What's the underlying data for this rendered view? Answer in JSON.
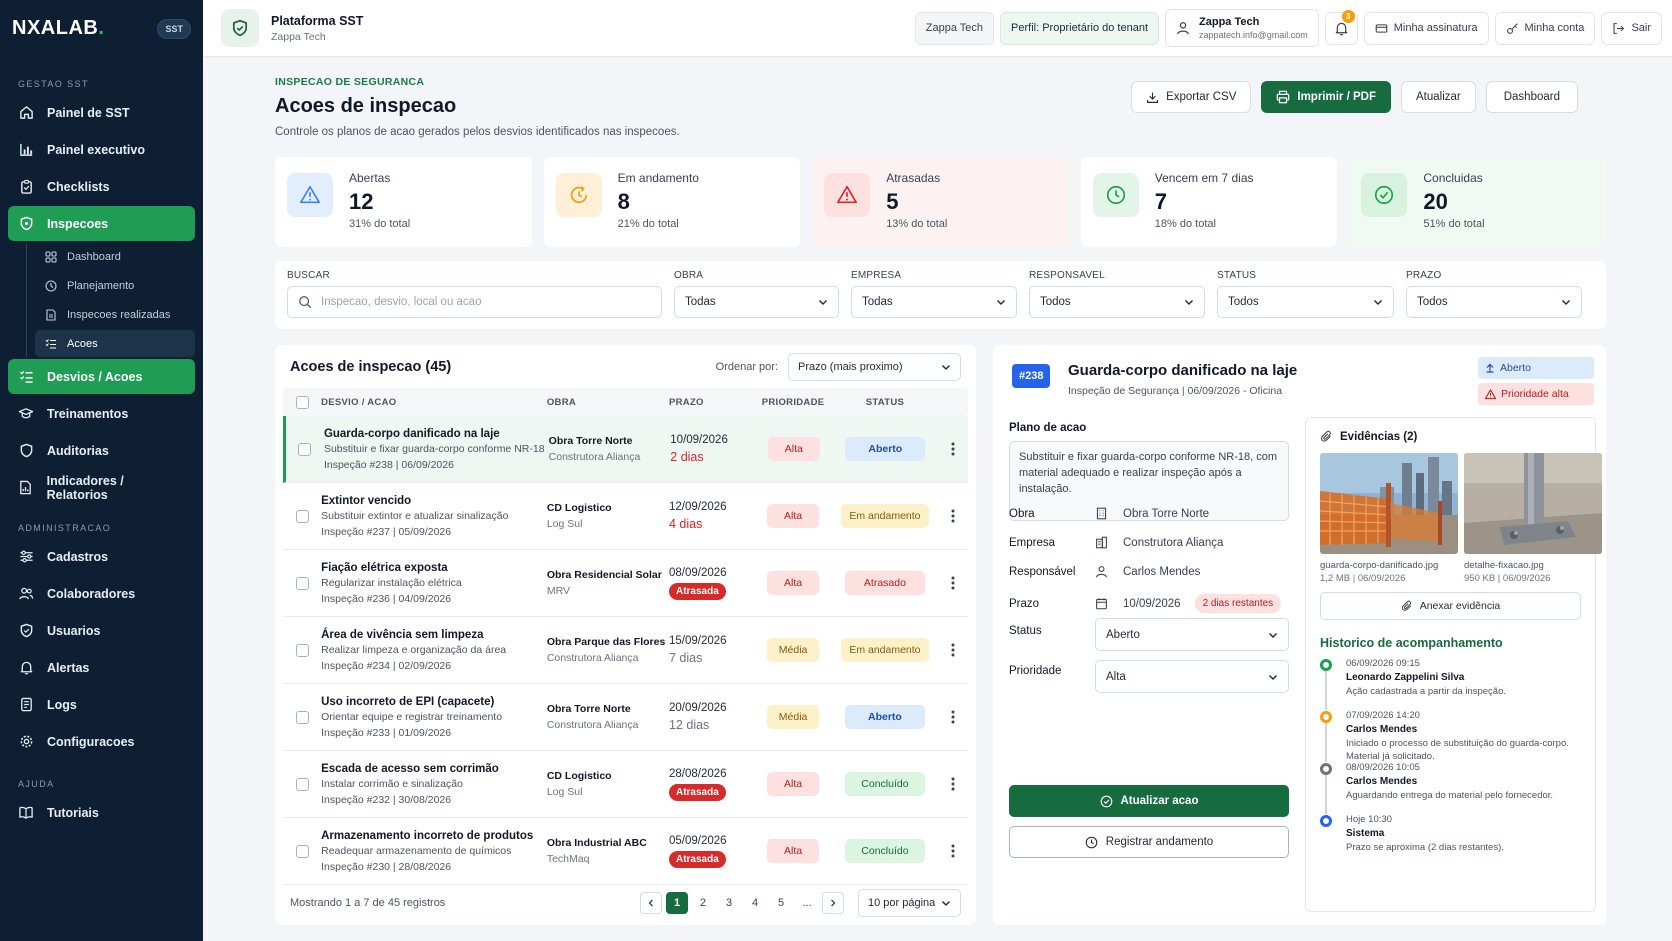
{
  "brand": {
    "logo": "NXALAB",
    "logo_dot": ".",
    "badge": "SST"
  },
  "sidebar": {
    "sections": [
      {
        "label": "GESTAO SST"
      },
      {
        "label": "ADMINISTRACAO"
      },
      {
        "label": "AJUDA"
      }
    ],
    "items": [
      {
        "label": "Painel de SST",
        "icon": "home-icon"
      },
      {
        "label": "Painel executivo",
        "icon": "bar-chart-icon"
      },
      {
        "label": "Checklists",
        "icon": "clipboard-icon"
      },
      {
        "label": "Inspecoes",
        "icon": "shield-icon",
        "active": true
      },
      {
        "label": "Desvios / Acoes",
        "icon": "list-check-icon",
        "active": true
      },
      {
        "label": "Treinamentos",
        "icon": "graduation-cap-icon"
      },
      {
        "label": "Auditorias",
        "icon": "shield-icon"
      },
      {
        "label": "Indicadores / Relatorios",
        "icon": "report-icon"
      },
      {
        "label": "Cadastros",
        "icon": "sliders-icon"
      },
      {
        "label": "Colaboradores",
        "icon": "users-icon"
      },
      {
        "label": "Usuarios",
        "icon": "shield-icon"
      },
      {
        "label": "Alertas",
        "icon": "bell-icon"
      },
      {
        "label": "Logs",
        "icon": "log-icon"
      },
      {
        "label": "Configuracoes",
        "icon": "gear-icon"
      },
      {
        "label": "Tutoriais",
        "icon": "book-icon"
      }
    ],
    "subitems": [
      {
        "label": "Dashboard",
        "icon": "grid-icon"
      },
      {
        "label": "Planejamento",
        "icon": "clock-icon"
      },
      {
        "label": "Inspecoes realizadas",
        "icon": "doc-icon"
      },
      {
        "label": "Acoes",
        "icon": "list-check-icon",
        "active": true
      }
    ]
  },
  "topbar": {
    "platform_title": "Plataforma SST",
    "platform_sub": "Zappa Tech",
    "tenant": "Zappa Tech",
    "profile": "Perfil: Proprietário do tenant",
    "user_name": "Zappa Tech",
    "user_email": "zappatech.info@gmail.com",
    "notif_count": "3",
    "subscription": "Minha assinatura",
    "account": "Minha conta",
    "logout": "Sair"
  },
  "page": {
    "eyebrow": "INSPECAO DE SEGURANCA",
    "title": "Acoes de inspecao",
    "description": "Controle os planos de acao gerados pelos desvios identificados nas inspecoes.",
    "actions": {
      "export": "Exportar CSV",
      "print": "Imprimir / PDF",
      "refresh": "Atualizar",
      "dashboard": "Dashboard"
    }
  },
  "stats": [
    {
      "label": "Abertas",
      "value": "12",
      "pct": "31% do total",
      "color": "#3b82f6"
    },
    {
      "label": "Em andamento",
      "value": "8",
      "pct": "21% do total",
      "color": "#f59e0b"
    },
    {
      "label": "Atrasadas",
      "value": "5",
      "pct": "13% do total",
      "color": "#dc2626"
    },
    {
      "label": "Vencem em 7 dias",
      "value": "7",
      "pct": "18% do total",
      "color": "#16a34a"
    },
    {
      "label": "Concluidas",
      "value": "20",
      "pct": "51% do total",
      "color": "#16a34a"
    }
  ],
  "filters": {
    "search_label": "BUSCAR",
    "search_placeholder": "Inspecao, desvio, local ou acao",
    "obra_label": "OBRA",
    "obra_value": "Todas",
    "empresa_label": "EMPRESA",
    "empresa_value": "Todas",
    "responsavel_label": "RESPONSAVEL",
    "responsavel_value": "Todos",
    "status_label": "STATUS",
    "status_value": "Todos",
    "prazo_label": "PRAZO",
    "prazo_value": "Todos"
  },
  "table": {
    "title": "Acoes de inspecao (45)",
    "sort_label": "Ordenar por:",
    "sort_value": "Prazo (mais proximo)",
    "headers": {
      "desvio": "DESVIO / ACAO",
      "obra": "OBRA",
      "prazo": "PRAZO",
      "prioridade": "PRIORIDADE",
      "status": "STATUS"
    },
    "rows": [
      {
        "title": "Guarda-corpo danificado na laje",
        "action": "Substituir e fixar guarda-corpo conforme NR-18",
        "meta": "Inspeção #238 | 06/09/2026",
        "obra": "Obra Torre Norte",
        "empresa": "Construtora Aliança",
        "date": "10/09/2026",
        "days": "2 dias",
        "days_style": "red",
        "priority": "Alta",
        "status": "Aberto"
      },
      {
        "title": "Extintor vencido",
        "action": "Substituir extintor e atualizar sinalização",
        "meta": "Inspeção #237 | 05/09/2026",
        "obra": "CD Logistico",
        "empresa": "Log Sul",
        "date": "12/09/2026",
        "days": "4 dias",
        "days_style": "red",
        "priority": "Alta",
        "status": "Em andamento"
      },
      {
        "title": "Fiação elétrica exposta",
        "action": "Regularizar instalação elétrica",
        "meta": "Inspeção #236 | 04/09/2026",
        "obra": "Obra Residencial Solar",
        "empresa": "MRV",
        "date": "08/09/2026",
        "days": "Atrasada",
        "days_style": "pill",
        "priority": "Alta",
        "status": "Atrasado"
      },
      {
        "title": "Área de vivência sem limpeza",
        "action": "Realizar limpeza e organização da área",
        "meta": "Inspeção #234 | 02/09/2026",
        "obra": "Obra Parque das Flores",
        "empresa": "Construtora Aliança",
        "date": "15/09/2026",
        "days": "7 dias",
        "days_style": "grey",
        "priority": "Média",
        "status": "Em andamento"
      },
      {
        "title": "Uso incorreto de EPI (capacete)",
        "action": "Orientar equipe e registrar treinamento",
        "meta": "Inspeção #233 | 01/09/2026",
        "obra": "Obra Torre Norte",
        "empresa": "Construtora Aliança",
        "date": "20/09/2026",
        "days": "12 dias",
        "days_style": "grey",
        "priority": "Média",
        "status": "Aberto"
      },
      {
        "title": "Escada de acesso sem corrimão",
        "action": "Instalar corrimão e sinalização",
        "meta": "Inspeção #232 | 30/08/2026",
        "obra": "CD Logistico",
        "empresa": "Log Sul",
        "date": "28/08/2026",
        "days": "Atrasada",
        "days_style": "pill",
        "priority": "Alta",
        "status": "Concluído"
      },
      {
        "title": "Armazenamento incorreto de produtos",
        "action": "Readequar armazenamento de químicos",
        "meta": "Inspeção #230 | 28/08/2026",
        "obra": "Obra Industrial ABC",
        "empresa": "TechMaq",
        "date": "05/09/2026",
        "days": "Atrasada",
        "days_style": "pill",
        "priority": "Alta",
        "status": "Concluído"
      }
    ],
    "footer_info": "Mostrando 1 a 7 de 45 registros",
    "pages": [
      "1",
      "2",
      "3",
      "4",
      "5",
      "..."
    ],
    "per_page": "10 por página"
  },
  "detail": {
    "id": "#238",
    "title": "Guarda-corpo danificado na laje",
    "subtitle": "Inspeção de Segurança | 06/09/2026 - Oficina",
    "status_badge": "Aberto",
    "priority_badge": "Prioridade alta",
    "plan_label": "Plano de acao",
    "plan_text": "Substituir e fixar guarda-corpo conforme NR-18, com material adequado e realizar inspeção após a instalação.",
    "obra_label": "Obra",
    "obra": "Obra Torre Norte",
    "empresa_label": "Empresa",
    "empresa": "Construtora Aliança",
    "resp_label": "Responsável",
    "resp": "Carlos Mendes",
    "prazo_label": "Prazo",
    "prazo": "10/09/2026",
    "prazo_pill": "2 dias restantes",
    "status_label": "Status",
    "status_value": "Aberto",
    "prio_label": "Prioridade",
    "prio_value": "Alta",
    "update_btn": "Atualizar acao",
    "register_btn": "Registrar andamento",
    "evidence_title": "Evidências (2)",
    "photos": [
      {
        "name": "guarda-corpo-danificado.jpg",
        "meta": "1,2 MB | 06/09/2026"
      },
      {
        "name": "detalhe-fixacao.jpg",
        "meta": "950 KB | 06/09/2026"
      }
    ],
    "attach_btn": "Anexar evidência",
    "history_title": "Historico de acompanhamento",
    "history": [
      {
        "date": "06/09/2026 09:15",
        "name": "Leonardo Zappelini Silva",
        "text": "Ação cadastrada a partir da inspeção.",
        "color": "#16a34a"
      },
      {
        "date": "07/09/2026 14:20",
        "name": "Carlos Mendes",
        "text": "Iniciado o processo de substituição do guarda-corpo. Material já solicitado.",
        "color": "#f59e0b"
      },
      {
        "date": "08/09/2026 10:05",
        "name": "Carlos Mendes",
        "text": "Aguardando entrega do material pelo fornecedor.",
        "color": "#6b7280"
      },
      {
        "date": "Hoje 10:30",
        "name": "Sistema",
        "text": "Prazo se aproxima (2 dias restantes).",
        "color": "#2563eb"
      }
    ]
  }
}
